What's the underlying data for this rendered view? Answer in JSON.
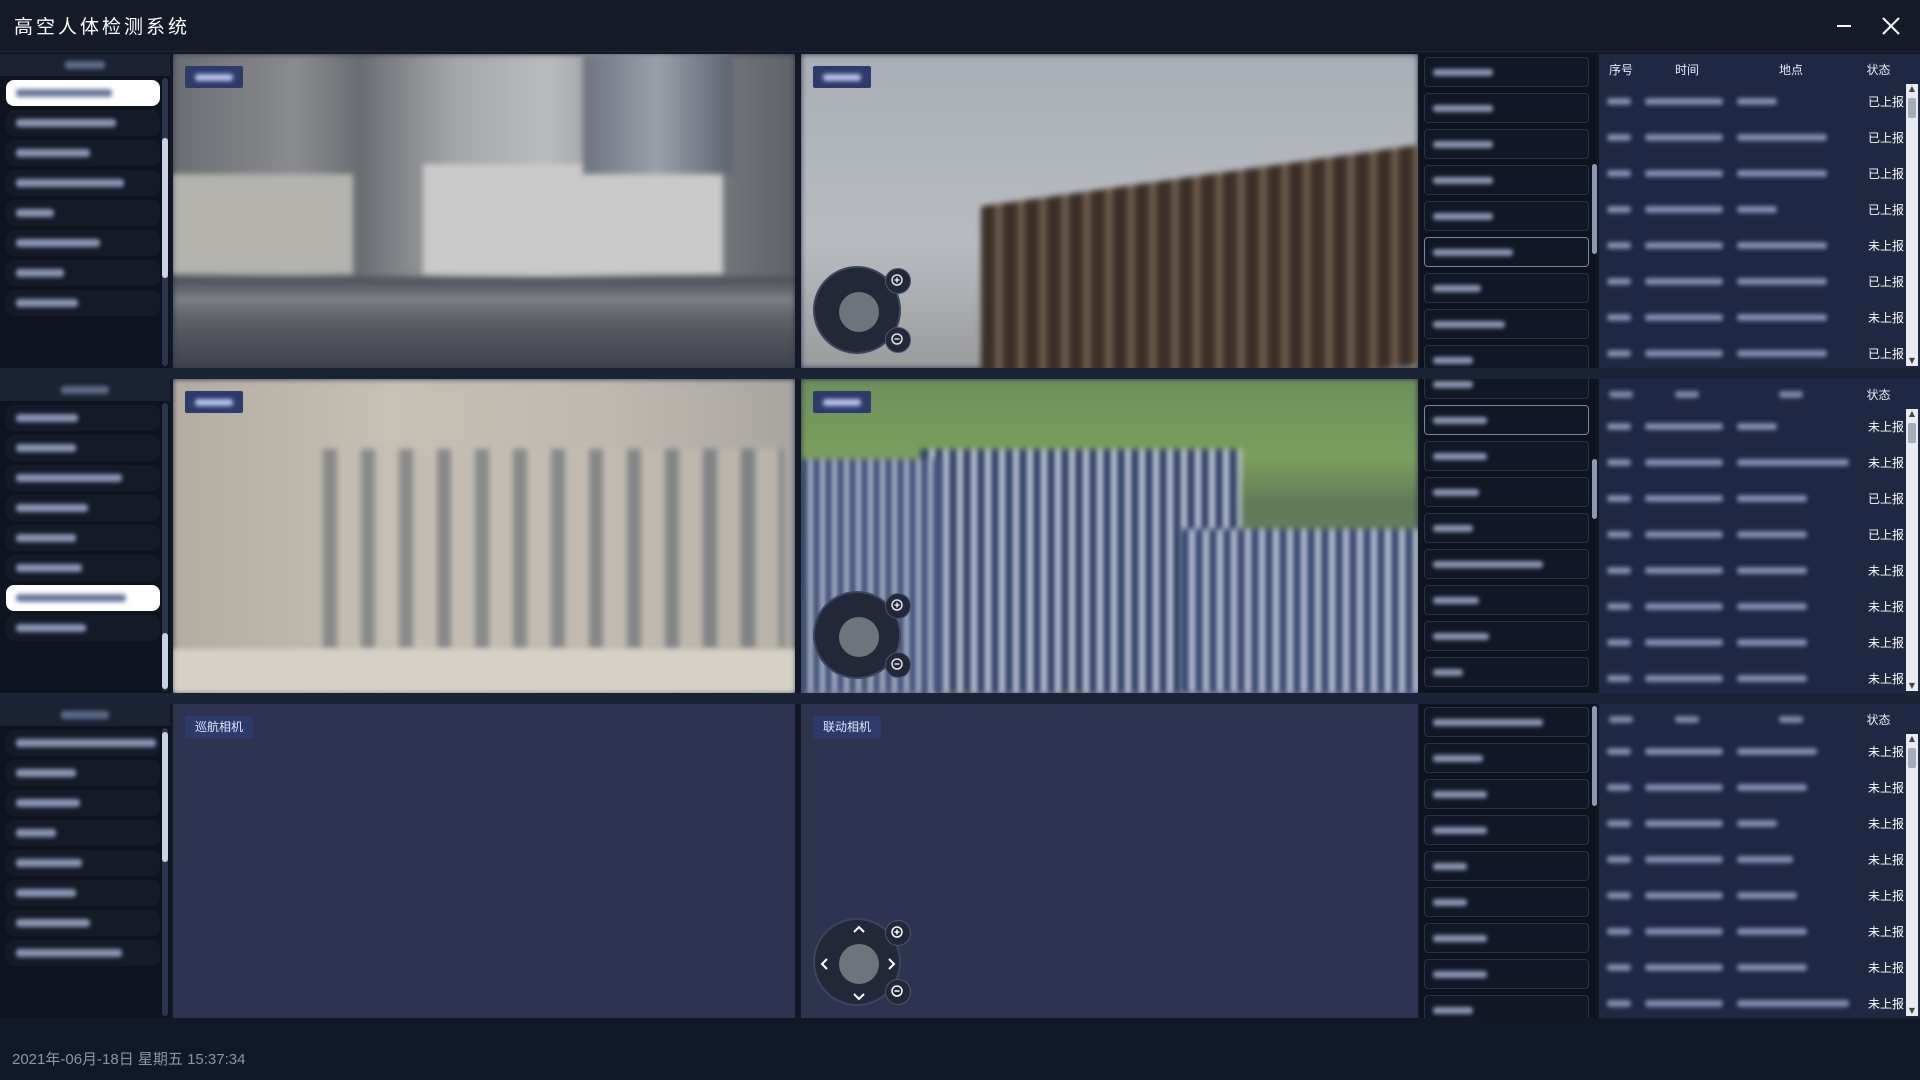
{
  "window": {
    "title": "高空人体检测系统"
  },
  "rows": [
    {
      "left_selected_index": 0,
      "left_item_count": 9,
      "cam_left_label": "",
      "cam_right_label": "",
      "dev_selected_index": 5,
      "table": {
        "headers": {
          "seq": "序号",
          "time": "时间",
          "loc": "地点",
          "status": "状态"
        },
        "statuses": [
          "已上报",
          "已上报",
          "已上报",
          "已上报",
          "未上报",
          "已上报",
          "未上报",
          "已上报"
        ]
      }
    },
    {
      "left_selected_index": 6,
      "left_item_count": 8,
      "cam_left_label": "",
      "cam_right_label": "",
      "dev_selected_index": 1,
      "table": {
        "headers": {
          "seq": "",
          "time": "",
          "loc": "",
          "status": "状态"
        },
        "statuses": [
          "未上报",
          "未上报",
          "已上报",
          "已上报",
          "未上报",
          "未上报",
          "未上报",
          "未上报"
        ]
      }
    },
    {
      "left_selected_index": -1,
      "left_item_count": 8,
      "cam_left_label": "巡航相机",
      "cam_right_label": "联动相机",
      "dev_selected_index": -1,
      "table": {
        "headers": {
          "seq": "",
          "time": "",
          "loc": "",
          "status": "状态"
        },
        "statuses": [
          "未上报",
          "未上报",
          "未上报",
          "未上报",
          "未上报",
          "未上报",
          "未上报",
          "未上报"
        ]
      }
    }
  ],
  "statusbar": {
    "datetime": "2021年-06月-18日 星期五 15:37:34"
  },
  "icons": [
    "minimize-icon",
    "close-icon",
    "zoom-in-icon",
    "zoom-out-icon",
    "pan-up-icon",
    "pan-down-icon",
    "pan-left-icon",
    "pan-right-icon"
  ],
  "colors": {
    "background": "#121826",
    "panel": "#2d3450",
    "table": "#1f2842",
    "badge": "#2d3b6b"
  }
}
